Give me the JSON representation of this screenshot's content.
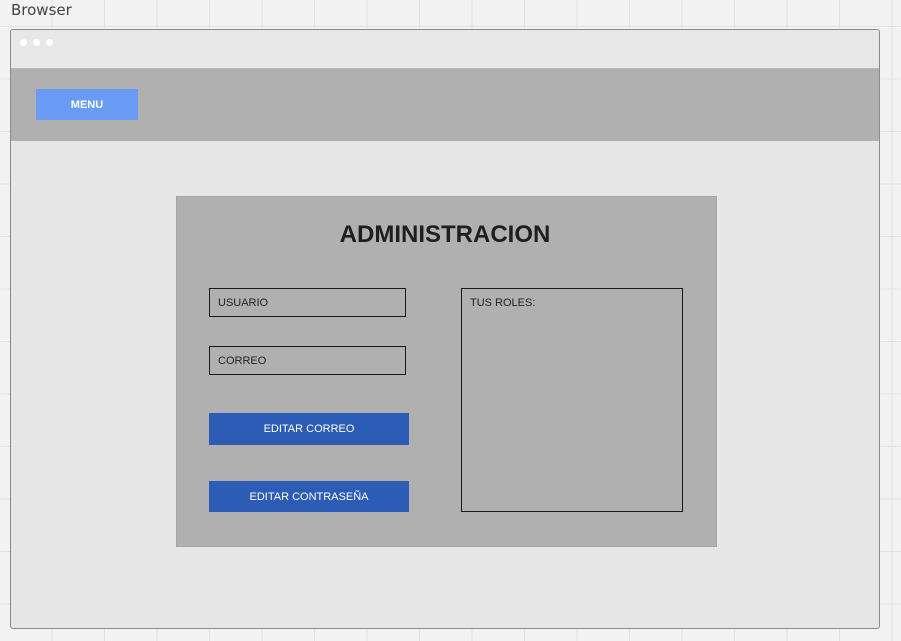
{
  "frame": {
    "label": "Browser"
  },
  "navbar": {
    "menu_label": "MENU"
  },
  "panel": {
    "title": "ADMINISTRACION",
    "usuario_placeholder": "USUARIO",
    "correo_placeholder": "CORREO",
    "edit_email_label": "EDITAR CORREO",
    "edit_password_label": "EDITAR CONTRASEÑA",
    "roles_label": "TUS ROLES:"
  },
  "colors": {
    "menu_button": "#6a9cf5",
    "action_button": "#2c5cb5",
    "panel": "#b0b0b0",
    "page_background": "#e6e6e6"
  }
}
